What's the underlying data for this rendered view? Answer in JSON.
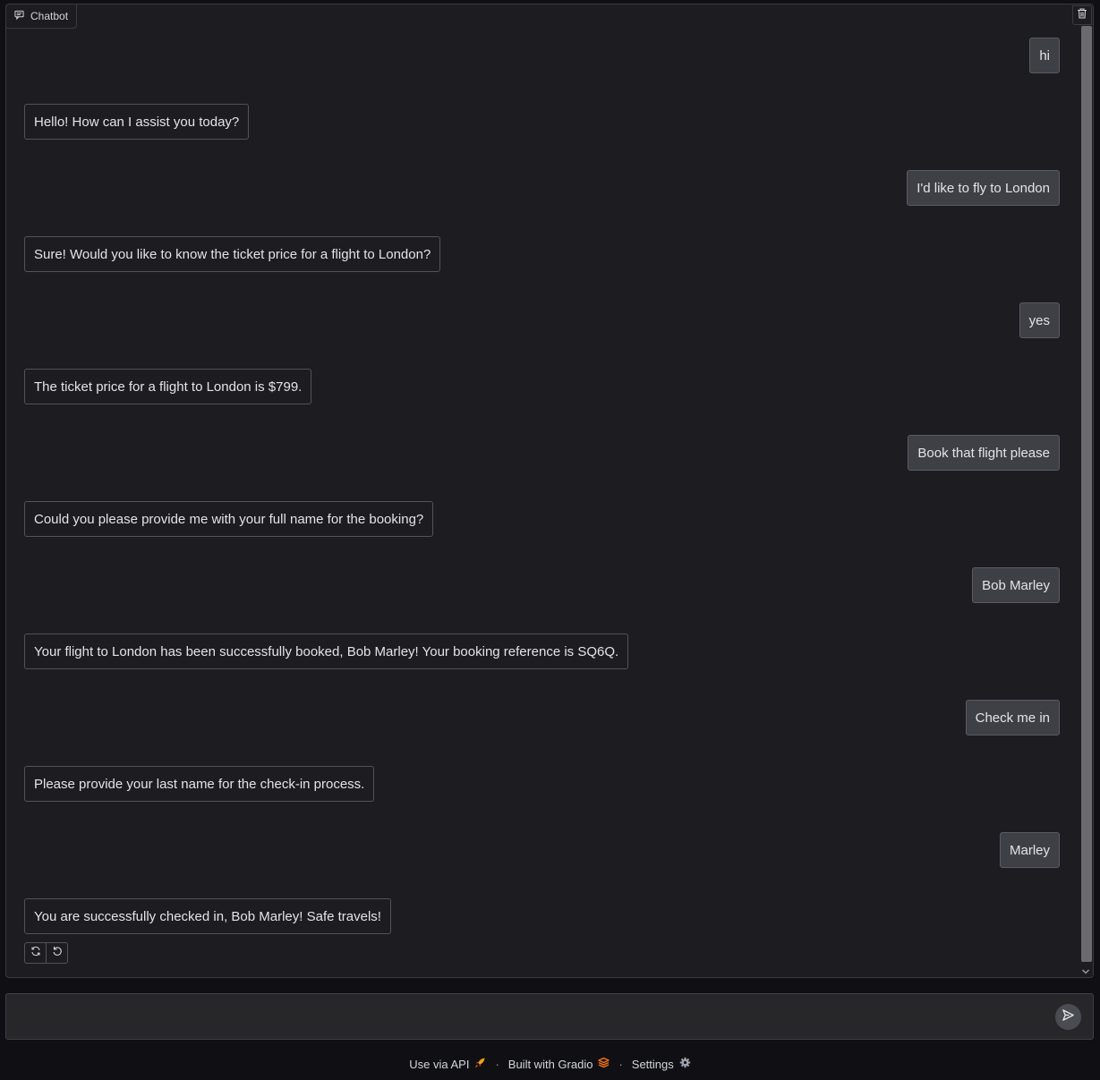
{
  "chatbot": {
    "label": "Chatbot",
    "messages": [
      {
        "role": "user",
        "text": "hi"
      },
      {
        "role": "bot",
        "text": "Hello! How can I assist you today?"
      },
      {
        "role": "user",
        "text": "I'd like to fly to London"
      },
      {
        "role": "bot",
        "text": "Sure! Would you like to know the ticket price for a flight to London?"
      },
      {
        "role": "user",
        "text": "yes"
      },
      {
        "role": "bot",
        "text": "The ticket price for a flight to London is $799."
      },
      {
        "role": "user",
        "text": "Book that flight please"
      },
      {
        "role": "bot",
        "text": "Could you please provide me with your full name for the booking?"
      },
      {
        "role": "user",
        "text": "Bob Marley"
      },
      {
        "role": "bot",
        "text": "Your flight to London has been successfully booked, Bob Marley! Your booking reference is SQ6Q."
      },
      {
        "role": "user",
        "text": "Check me in"
      },
      {
        "role": "bot",
        "text": "Please provide your last name for the check-in process."
      },
      {
        "role": "user",
        "text": "Marley"
      },
      {
        "role": "bot",
        "text": "You are successfully checked in, Bob Marley! Safe travels!"
      }
    ]
  },
  "input": {
    "value": "",
    "placeholder": ""
  },
  "footer": {
    "api_label": "Use via API",
    "built_label": "Built with Gradio",
    "settings_label": "Settings",
    "separator": "·"
  },
  "colors": {
    "background": "#101014",
    "panel": "#1d1c21",
    "user_bubble": "#3f3f46",
    "gradio_accent": "#f97316"
  }
}
